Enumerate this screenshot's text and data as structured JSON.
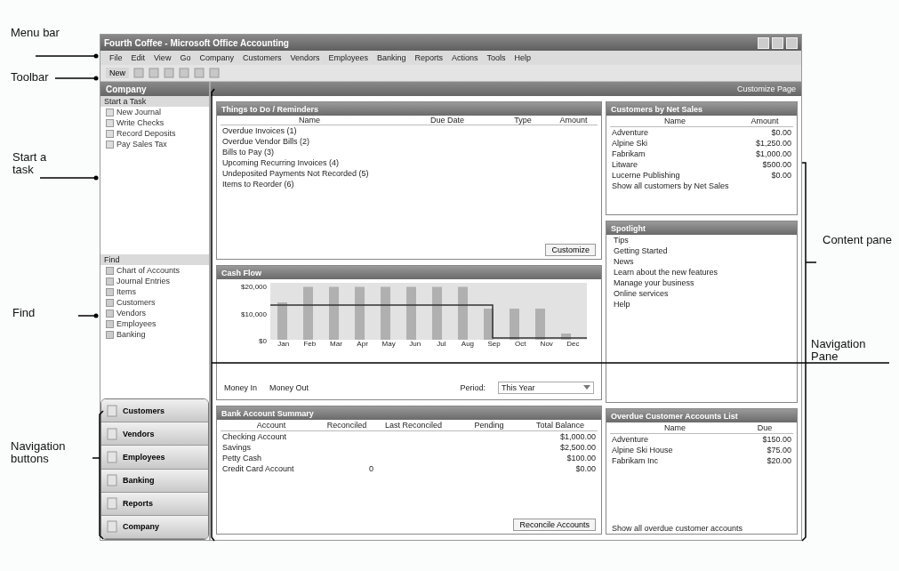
{
  "callouts": [
    {
      "text": "Menu bar"
    },
    {
      "text": "Toolbar"
    },
    {
      "text": "Start a task"
    },
    {
      "text": "Find"
    },
    {
      "text": "Navigation buttons"
    },
    {
      "text": "Content pane"
    },
    {
      "text": "Navigation Pane"
    }
  ],
  "window": {
    "title": "Fourth Coffee - Microsoft Office Accounting"
  },
  "menu": [
    "File",
    "Edit",
    "View",
    "Go",
    "Company",
    "Customers",
    "Vendors",
    "Employees",
    "Banking",
    "Reports",
    "Actions",
    "Tools",
    "Help"
  ],
  "toolbar": {
    "new_label": "New"
  },
  "sidebar": {
    "title": "Company",
    "start_heading": "Start a Task",
    "start_items": [
      "New Journal",
      "Write Checks",
      "Record Deposits",
      "Pay Sales Tax"
    ],
    "find_heading": "Find",
    "find_items": [
      "Chart of Accounts",
      "Journal Entries",
      "Items",
      "Customers",
      "Vendors",
      "Employees",
      "Banking"
    ],
    "nav_buttons": [
      "Customers",
      "Vendors",
      "Employees",
      "Banking",
      "Reports",
      "Company"
    ]
  },
  "content": {
    "header_link": "Customize Page"
  },
  "reminders": {
    "title": "Things to Do / Reminders",
    "columns": [
      "Name",
      "Due Date",
      "Type",
      "Amount"
    ],
    "items": [
      "Overdue Invoices (1)",
      "Overdue Vendor Bills (2)",
      "Bills to Pay (3)",
      "Upcoming Recurring Invoices (4)",
      "Undeposited Payments Not Recorded (5)",
      "Items to Reorder (6)"
    ],
    "button": "Customize"
  },
  "cash_flow": {
    "title": "Cash Flow",
    "y_labels": [
      "$20,000",
      "$10,000",
      "$0"
    ],
    "x_labels": [
      "Jan",
      "Feb",
      "Mar",
      "Apr",
      "May",
      "Jun",
      "Jul",
      "Aug",
      "Sep",
      "Oct",
      "Nov",
      "Dec"
    ],
    "legend": [
      "Money In",
      "Money Out"
    ],
    "period_label": "Period:",
    "period_value": "This Year"
  },
  "bank": {
    "title": "Bank Account Summary",
    "columns": [
      "Account",
      "Reconciled",
      "Last Reconciled",
      "Pending",
      "Total Balance"
    ],
    "rows": [
      [
        "Checking Account",
        "",
        "",
        "",
        "$1,000.00"
      ],
      [
        "Savings",
        "",
        "",
        "",
        "$2,500.00"
      ],
      [
        "Petty Cash",
        "",
        "",
        "",
        "$100.00"
      ],
      [
        "Credit Card Account",
        "0",
        "",
        "",
        "$0.00"
      ]
    ],
    "button": "Reconcile Accounts"
  },
  "top_customers": {
    "title": "Customers by Net Sales",
    "columns": [
      "Name",
      "Amount"
    ],
    "rows": [
      [
        "Adventure",
        "$0.00"
      ],
      [
        "Alpine Ski",
        "$1,250.00"
      ],
      [
        "Fabrikam",
        "$1,000.00"
      ],
      [
        "Litware",
        "$500.00"
      ],
      [
        "Lucerne Publishing",
        "$0.00"
      ]
    ],
    "link": "Show all customers by Net Sales"
  },
  "spotlight": {
    "title": "Spotlight",
    "items": [
      "Tips",
      "Getting Started",
      "News",
      "Learn about the new features",
      "Manage your business",
      "Online services",
      "Help"
    ]
  },
  "overdue": {
    "title": "Overdue Customer Accounts List",
    "columns": [
      "Name",
      "Due"
    ],
    "rows": [
      [
        "Adventure",
        "$150.00"
      ],
      [
        "Alpine Ski House",
        "$75.00"
      ],
      [
        "Fabrikam Inc",
        "$20.00"
      ]
    ],
    "link": "Show all overdue customer accounts"
  }
}
